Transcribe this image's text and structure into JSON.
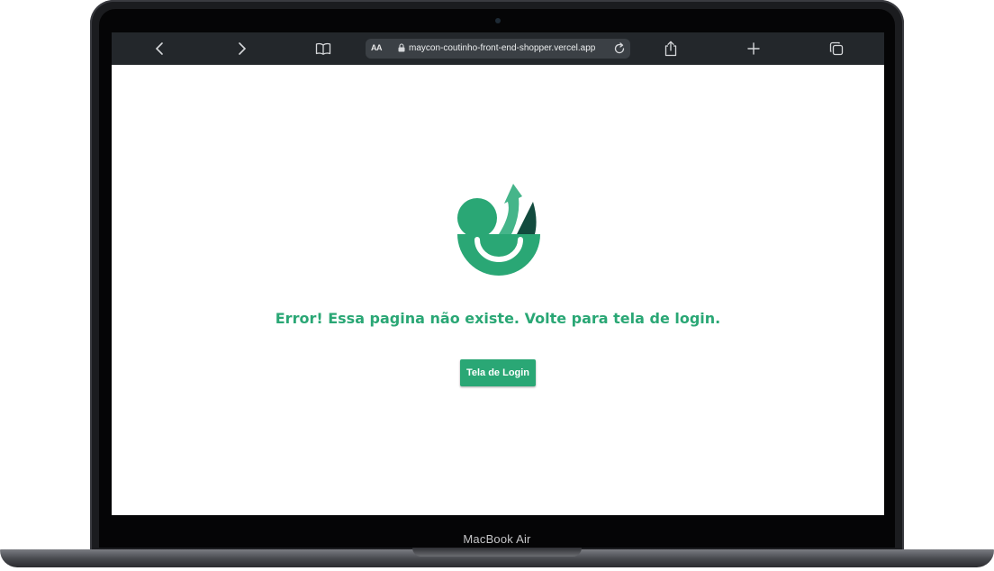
{
  "device": {
    "label": "MacBook Air"
  },
  "browser": {
    "text_size_label": "AA",
    "url": "maycon-coutinho-front-end-shopper.vercel.app",
    "icons": [
      "chevron-left-icon",
      "chevron-right-icon",
      "book-icon",
      "lock-icon",
      "reload-icon",
      "share-icon",
      "plus-icon",
      "tabs-icon"
    ]
  },
  "page": {
    "error_message": "Error! Essa pagina não existe. Volte para tela de login.",
    "login_button_label": "Tela de Login"
  },
  "colors": {
    "accent": "#2aa775",
    "toolbar": "#23272b",
    "logo_dark": "#124b3e"
  }
}
